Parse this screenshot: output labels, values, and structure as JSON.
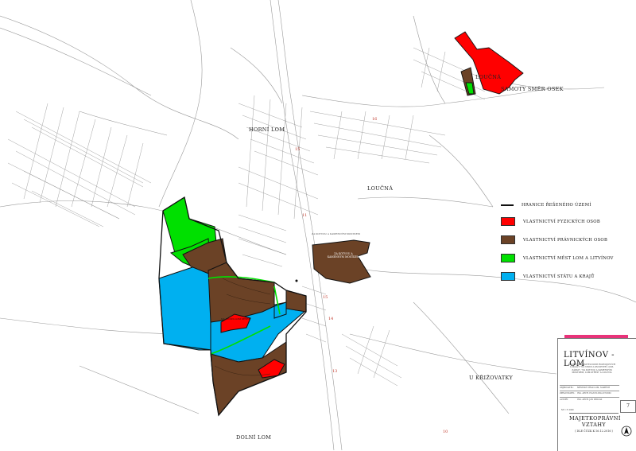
{
  "places": {
    "horni_lom": "HORNÍ LOM",
    "loucna_town": "LOUČNÁ",
    "loucna_small": "LOUČNÁ",
    "samoty": "SAMOTY SMĚR OSEK",
    "dolni_lom": "DOLNÍ LOM",
    "u_krizovatky": "U KŘIŽOVATKY"
  },
  "area_labels": {
    "za_kotvou": "ZA KOTVOU A\nKAMENNÝM MOSTKEM",
    "na_vinici": "NA VINICI-LOM SEVER",
    "za_kotvou_small": "ZA KOTVOU A KAMENNÝM MOSTKEM"
  },
  "sheet_numbers": [
    "16",
    "15",
    "15",
    "14",
    "13",
    "10",
    "11"
  ],
  "legend": {
    "items": [
      {
        "label": "HRANICE ŘEŠENÉHO ÚZEMÍ",
        "kind": "line",
        "color": "#111111"
      },
      {
        "label": "VLASTNICTVÍ FYZICKÝCH OSOB",
        "kind": "fill",
        "color": "#ff0000"
      },
      {
        "label": "VLASTNICTVÍ PRÁVNICKÝCH OSOB",
        "kind": "fill",
        "color": "#6b4226"
      },
      {
        "label": "VLASTNICTVÍ MĚST LOM A LITVÍNOV",
        "kind": "fill",
        "color": "#00e000"
      },
      {
        "label": "VLASTNICTVÍ STÁTU A KRAJŮ",
        "kind": "fill",
        "color": "#00b0f0"
      }
    ]
  },
  "title_block": {
    "city": "LITVÍNOV - LOM",
    "subtitle": "STUDIE ZASTAVITELNOSTI ROZVOJOVÝCH LOKALIT \"NA VINICI-LOM SEVER, LOM-ZÁPAD\", \"ZA KOTVOU A KAMENNÝM MOSTKEM, LOM-STŘED\" A LOUČNÁ",
    "rows": [
      {
        "k": "OBJEDNATEL:",
        "v": "MĚSTSKÝ ÚŘAD LOM, NÁMĚSTÍ"
      },
      {
        "k": "ZPRACOVATEL:",
        "v": "ING. ARCH. IVAN PLICKA STUDIO"
      },
      {
        "k": "AUTOŘI:",
        "v": "ING. ARCH. JAN SEDLÁK"
      }
    ],
    "scale": "M 1:5 000",
    "sheet": "7",
    "main_title": "MAJETKOPRÁVNÍ VZTAHY",
    "date": "( DLE ČÚZK K 16.12.2016 )"
  },
  "colors": {
    "private": "#ff0000",
    "legal": "#6b4226",
    "municipal": "#00e000",
    "state": "#00b0f0",
    "accent": "#e8337a"
  }
}
